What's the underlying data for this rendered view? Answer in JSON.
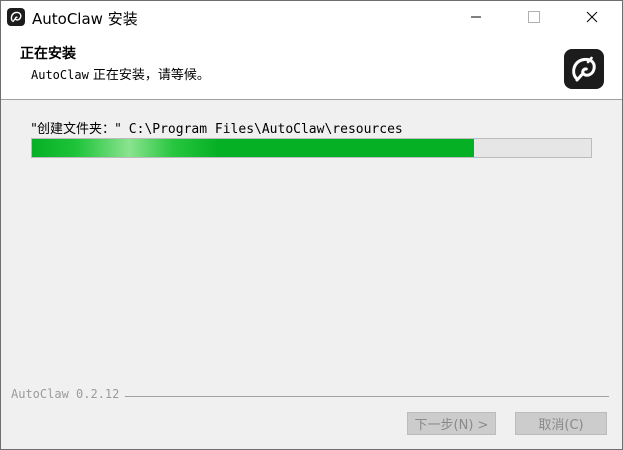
{
  "window": {
    "title": "AutoClaw 安装",
    "app_icon": "autoclaw-logo-icon",
    "controls": [
      "minimize-icon",
      "maximize-icon",
      "close-icon"
    ]
  },
  "header": {
    "title": "正在安装",
    "subtitle_app": "AutoClaw",
    "subtitle_text": " 正在安装，请等候。",
    "logo": "autoclaw-logo-icon"
  },
  "install": {
    "detail_label": "\"创建文件夹：\"",
    "detail_path": " C:\\Program Files\\AutoClaw\\resources",
    "progress_fraction": 0.79
  },
  "footer": {
    "brand": "AutoClaw 0.2.12",
    "next_label": "下一步(N) >",
    "cancel_label": "取消(C)"
  },
  "colors": {
    "progress_green": "#06b025",
    "disabled_button": "#cccccc",
    "logo_bg": "#1c1c1c"
  }
}
